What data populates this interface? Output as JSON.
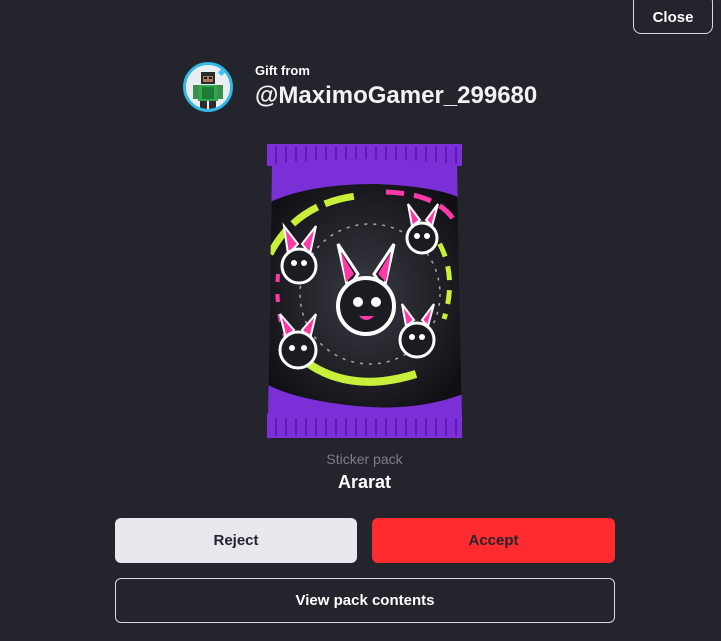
{
  "header": {
    "close_label": "Close"
  },
  "gift": {
    "from_label": "Gift from",
    "username": "@MaximoGamer_299680",
    "avatar_icon": "player-avatar-icon",
    "avatar_ring_color": "#2fb8e8"
  },
  "pack": {
    "image_icon": "sticker-pack-icon",
    "type_label": "Sticker pack",
    "name": "Ararat",
    "wrapper_color": "#7b2fd6",
    "accent_color": "#ff3aa8",
    "lime_color": "#c8f03a"
  },
  "actions": {
    "reject_label": "Reject",
    "accept_label": "Accept",
    "view_label": "View pack contents",
    "accept_color": "#ff2b2f",
    "reject_color": "#e8e9ef"
  }
}
